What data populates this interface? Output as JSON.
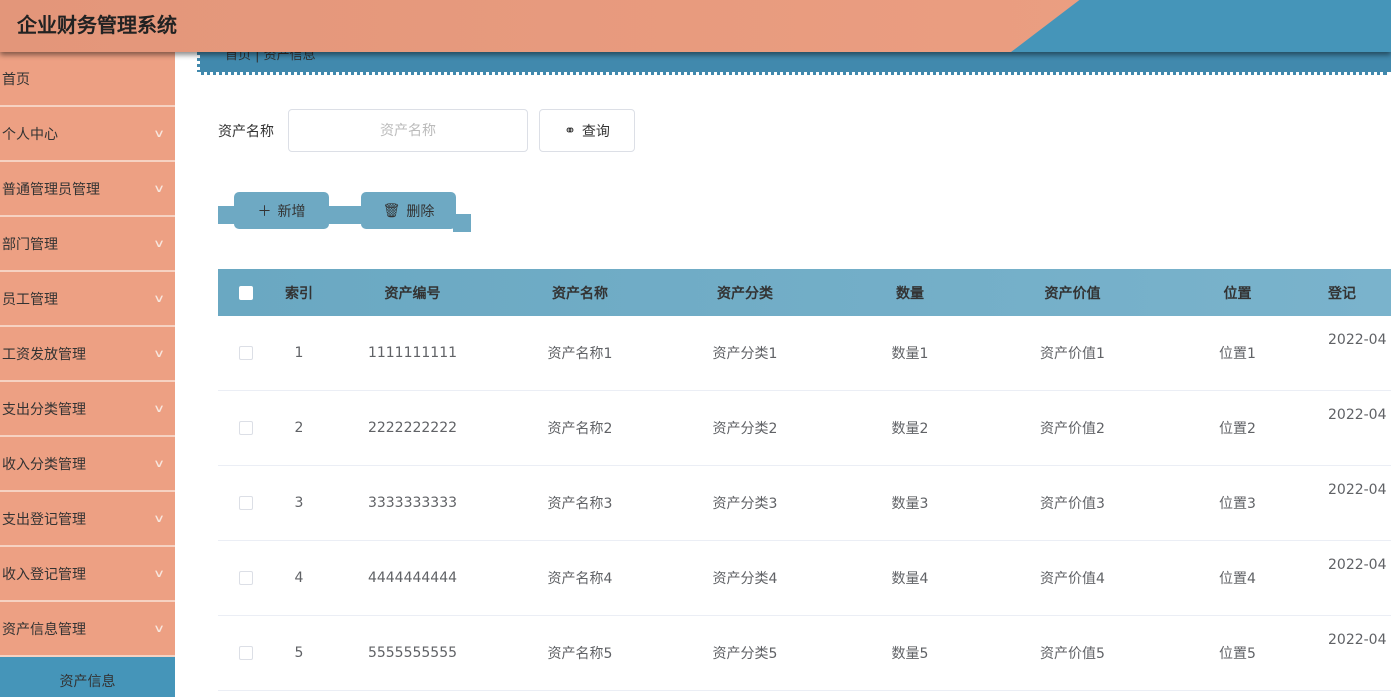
{
  "app_title": "企业财务管理系统",
  "breadcrumb": [
    "首页",
    "资产信息"
  ],
  "sidebar": {
    "items": [
      "首页",
      "个人中心",
      "普通管理员管理",
      "部门管理",
      "员工管理",
      "工资发放管理",
      "支出分类管理",
      "收入分类管理",
      "支出登记管理",
      "收入登记管理",
      "资产信息管理"
    ],
    "active_sub": "资产信息"
  },
  "search": {
    "label": "资产名称",
    "placeholder": "资产名称",
    "button": "查询"
  },
  "actions": {
    "add": "新增",
    "delete": "删除"
  },
  "table": {
    "headers": [
      "索引",
      "资产编号",
      "资产名称",
      "资产分类",
      "数量",
      "资产价值",
      "位置",
      "登记"
    ],
    "rows": [
      [
        "1",
        "1111111111",
        "资产名称1",
        "资产分类1",
        "数量1",
        "资产价值1",
        "位置1",
        "2022-04"
      ],
      [
        "2",
        "2222222222",
        "资产名称2",
        "资产分类2",
        "数量2",
        "资产价值2",
        "位置2",
        "2022-04"
      ],
      [
        "3",
        "3333333333",
        "资产名称3",
        "资产分类3",
        "数量3",
        "资产价值3",
        "位置3",
        "2022-04"
      ],
      [
        "4",
        "4444444444",
        "资产名称4",
        "资产分类4",
        "数量4",
        "资产价值4",
        "位置4",
        "2022-04"
      ],
      [
        "5",
        "5555555555",
        "资产名称5",
        "资产分类5",
        "数量5",
        "资产价值5",
        "位置5",
        "2022-04"
      ]
    ]
  },
  "colors": {
    "header": "#e8977a",
    "accent": "#4595b9",
    "table_header": "#6ea9c3"
  }
}
